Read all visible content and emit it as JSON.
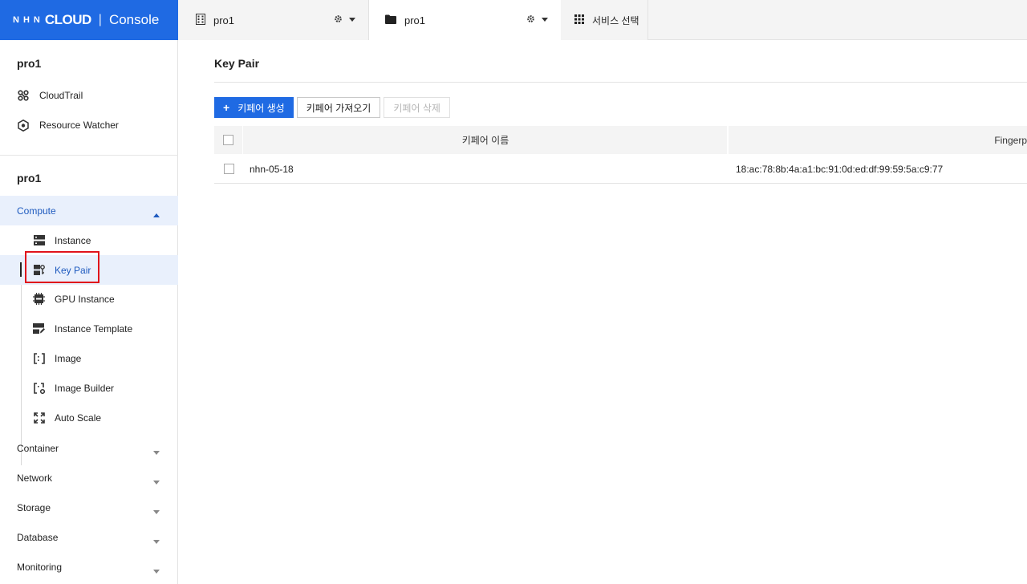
{
  "header": {
    "logo_nhn": "NHN",
    "logo_cloud": "CLOUD",
    "logo_sep": "|",
    "logo_console": "Console",
    "org_name": "pro1",
    "project_name": "pro1",
    "service_select": "서비스 선택"
  },
  "sidebar": {
    "org_title": "pro1",
    "org_links": [
      {
        "label": "CloudTrail",
        "icon": "cloudtrail-icon"
      },
      {
        "label": "Resource Watcher",
        "icon": "resource-watcher-icon"
      }
    ],
    "project_title": "pro1",
    "categories": {
      "compute": "Compute",
      "container": "Container",
      "network": "Network",
      "storage": "Storage",
      "database": "Database",
      "monitoring": "Monitoring"
    },
    "compute_items": [
      {
        "label": "Instance",
        "icon": "instance-icon"
      },
      {
        "label": "Key Pair",
        "icon": "key-pair-icon",
        "active": true
      },
      {
        "label": "GPU Instance",
        "icon": "gpu-icon"
      },
      {
        "label": "Instance Template",
        "icon": "template-icon"
      },
      {
        "label": "Image",
        "icon": "image-icon"
      },
      {
        "label": "Image Builder",
        "icon": "image-builder-icon"
      },
      {
        "label": "Auto Scale",
        "icon": "auto-scale-icon"
      }
    ]
  },
  "main": {
    "title": "Key Pair",
    "buttons": {
      "create": "키페어 생성",
      "create_icon": "+",
      "import": "키페어 가져오기",
      "delete": "키페어 삭제"
    },
    "table": {
      "columns": [
        "키페어 이름",
        "Fingerp"
      ],
      "rows": [
        {
          "name": "nhn-05-18",
          "fingerprint": "18:ac:78:8b:4a:a1:bc:91:0d:ed:df:99:59:5a:c9:77"
        }
      ]
    }
  },
  "colors": {
    "brand": "#1f6ae3",
    "active_bg": "#e9f0fc",
    "active_text": "#1f5bbf",
    "highlight": "#e0131b"
  }
}
